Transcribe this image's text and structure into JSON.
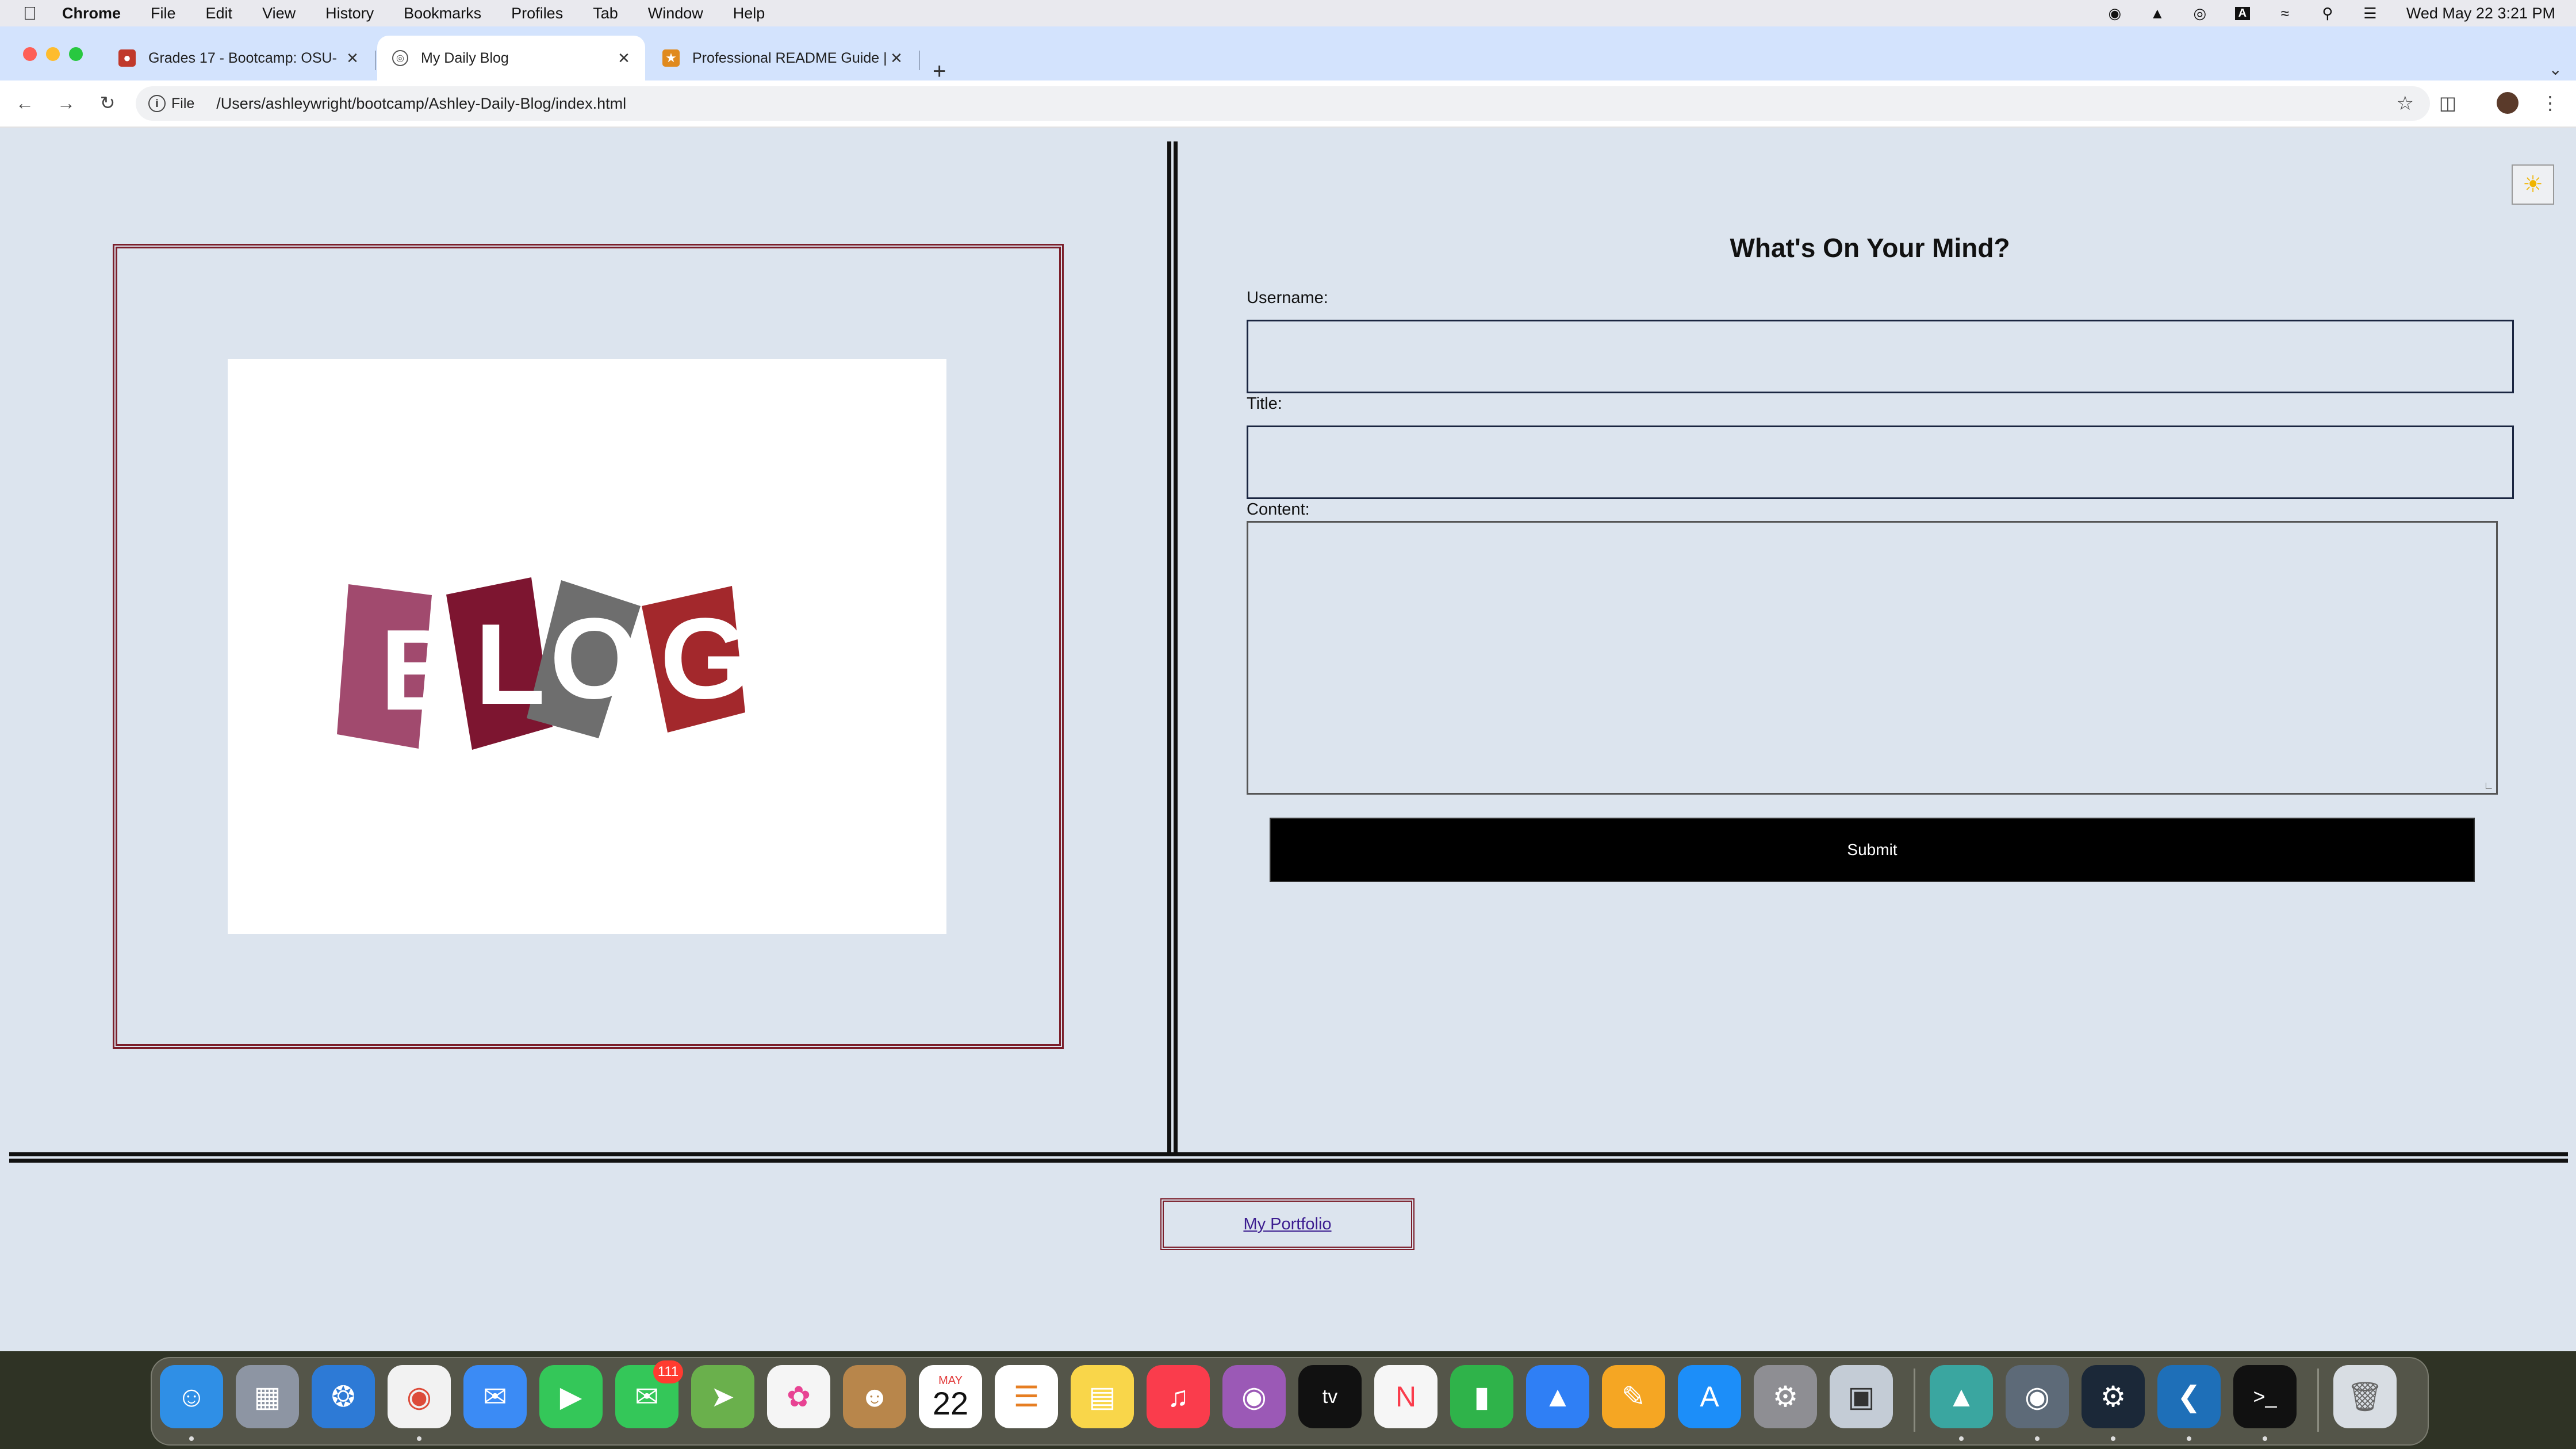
{
  "menubar": {
    "app_name": "Chrome",
    "items": [
      "File",
      "Edit",
      "View",
      "History",
      "Bookmarks",
      "Profiles",
      "Tab",
      "Window",
      "Help"
    ],
    "clock": "Wed May 22  3:21 PM"
  },
  "tabs": [
    {
      "title": "Grades 17 - Bootcamp: OSU-",
      "favicon": "canvas-icon",
      "active": false
    },
    {
      "title": "My Daily Blog",
      "favicon": "globe-icon",
      "active": true
    },
    {
      "title": "Professional README Guide |",
      "favicon": "readme-icon",
      "active": false
    }
  ],
  "toolbar": {
    "security_chip": "File",
    "url": "/Users/ashleywright/bootcamp/Ashley-Daily-Blog/index.html"
  },
  "page": {
    "hero_image_text": "BLOG",
    "form": {
      "title": "What's On Your Mind?",
      "username_label": "Username:",
      "title_label": "Title:",
      "content_label": "Content:",
      "username_value": "",
      "title_value": "",
      "content_value": "",
      "submit_label": "Submit"
    },
    "theme_toggle_icon": "sun-icon",
    "footer_link": "My Portfolio"
  },
  "dock": {
    "apps": [
      "Finder",
      "Launchpad",
      "Safari",
      "Chrome",
      "Mail",
      "FaceTime",
      "Messages",
      "Maps",
      "Photos",
      "Contacts",
      "Calendar",
      "Reminders",
      "Notes",
      "Music",
      "Podcasts",
      "TV",
      "News",
      "Numbers",
      "Keynote",
      "Pages",
      "App Store",
      "System Settings",
      "Preview",
      "Mountain Duck",
      "Cyberduck",
      "Steam",
      "VS Code",
      "Terminal",
      "Trash"
    ],
    "messages_badge": "111",
    "calendar_month": "MAY",
    "calendar_day": "22",
    "tv_label": "tv"
  },
  "colors": {
    "page_bg": "#dce4ee",
    "frame_maroon": "#7b1e2a",
    "submit_bg": "#000000",
    "tab_strip": "#d3e3fd"
  }
}
